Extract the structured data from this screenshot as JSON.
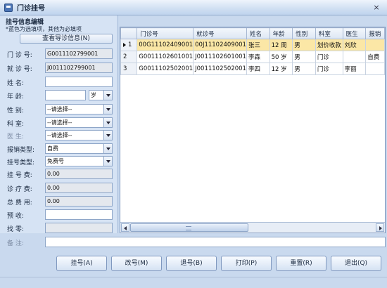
{
  "window": {
    "title": "门诊挂号",
    "close_glyph": "×"
  },
  "form": {
    "group_title": "挂号信息编辑",
    "hint": "*蓝色为选填项，其他为必填项",
    "lookup_button": "查看导诊信息(N)",
    "fields": {
      "outpatient_no": {
        "label": "门 诊 号:",
        "value": "G0011102799001"
      },
      "visit_no": {
        "label": "就 诊 号:",
        "value": "J0011102799001"
      },
      "name": {
        "label": "姓    名:",
        "value": ""
      },
      "age": {
        "label": "年    龄:",
        "value": "",
        "unit": "岁"
      },
      "gender": {
        "label": "性    别:",
        "value": "--请选择--"
      },
      "department": {
        "label": "科    室:",
        "value": "--请选择--"
      },
      "doctor": {
        "label": "医    生:",
        "value": "--请选择--"
      },
      "reimburse_type": {
        "label": "报销类型:",
        "value": "自费"
      },
      "register_type": {
        "label": "挂号类型:",
        "value": "免费号"
      },
      "register_fee": {
        "label": "挂 号 费:",
        "value": "0.00"
      },
      "consult_fee": {
        "label": "诊 疗 费:",
        "value": "0.00"
      },
      "total_fee": {
        "label": "总 费 用:",
        "value": "0.00"
      },
      "prepaid": {
        "label": "预    收:",
        "value": ""
      },
      "change": {
        "label": "找    零:",
        "value": ""
      },
      "remark": {
        "label": "备    注:",
        "value": ""
      }
    }
  },
  "grid": {
    "columns": [
      "门诊号",
      "就诊号",
      "姓名",
      "年龄",
      "性别",
      "科室",
      "医生",
      "报销"
    ],
    "rows": [
      {
        "index": "1",
        "cells": [
          "00G11102409001",
          "00J11102409001",
          "张三",
          "12 周",
          "男",
          "划价收款",
          "刘欣",
          ""
        ]
      },
      {
        "index": "2",
        "cells": [
          "G0011102601001",
          "J0011102601001",
          "李森",
          "50 岁",
          "男",
          "门诊",
          "",
          "自费"
        ]
      },
      {
        "index": "3",
        "cells": [
          "G0011102502001",
          "J0011102502001",
          "李四",
          "12 岁",
          "男",
          "门诊",
          "李丽",
          ""
        ]
      }
    ]
  },
  "buttons": {
    "register": "挂号(A)",
    "modify": "改号(M)",
    "refund": "退号(B)",
    "print": "打印(P)",
    "reset": "重置(R)",
    "exit": "退出(Q)"
  }
}
